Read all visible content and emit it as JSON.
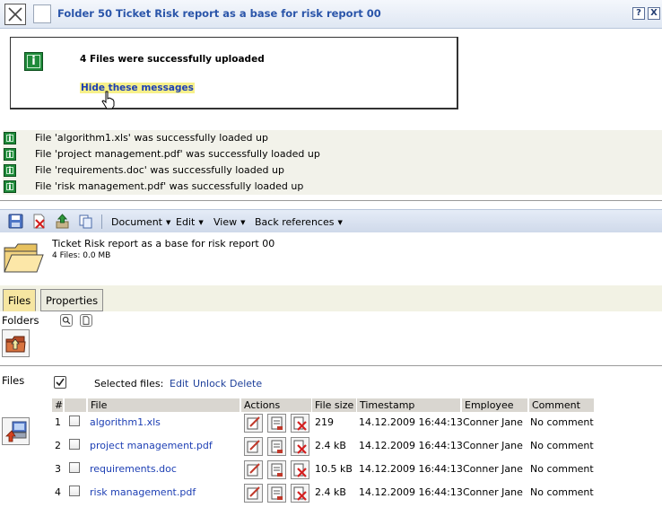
{
  "window": {
    "title": "Folder 50 Ticket Risk report as a base for risk report 00",
    "help_label": "?",
    "close_label": "X"
  },
  "message": {
    "text": "4 Files were successfully uploaded",
    "hide_link": "Hide these messages"
  },
  "upload_messages": [
    "File 'algorithm1.xls' was successfully loaded up",
    "File 'project management.pdf' was successfully loaded up",
    "File 'requirements.doc' was successfully loaded up",
    "File 'risk management.pdf' was successfully loaded up"
  ],
  "toolbar": {
    "icons": [
      "save-icon",
      "delete-icon",
      "upload-icon",
      "copy-icon"
    ],
    "menus": [
      {
        "label": "Document"
      },
      {
        "label": "Edit"
      },
      {
        "label": "View"
      },
      {
        "label": "Back references"
      }
    ]
  },
  "ticket": {
    "title": "Ticket Risk report as a base for risk report 00",
    "summary": "4 Files: 0.0 MB"
  },
  "tabs": [
    {
      "label": "Files",
      "active": true
    },
    {
      "label": "Properties",
      "active": false
    }
  ],
  "folders": {
    "label": "Folders"
  },
  "files": {
    "label": "Files",
    "selected_label": "Selected files:",
    "selected_actions": [
      "Edit",
      "Unlock",
      "Delete"
    ],
    "columns": [
      "#",
      "",
      "File",
      "Actions",
      "File size",
      "Timestamp",
      "Employee",
      "Comment"
    ],
    "rows": [
      {
        "num": "1",
        "name": "algorithm1.xls",
        "size": "219",
        "timestamp": "14.12.2009 16:44:13",
        "employee": "Conner Jane",
        "comment": "No comment"
      },
      {
        "num": "2",
        "name": "project management.pdf",
        "size": "2.4 kB",
        "timestamp": "14.12.2009 16:44:13",
        "employee": "Conner Jane",
        "comment": "No comment"
      },
      {
        "num": "3",
        "name": "requirements.doc",
        "size": "10.5 kB",
        "timestamp": "14.12.2009 16:44:13",
        "employee": "Conner Jane",
        "comment": "No comment"
      },
      {
        "num": "4",
        "name": "risk management.pdf",
        "size": "2.4 kB",
        "timestamp": "14.12.2009 16:44:13",
        "employee": "Conner Jane",
        "comment": "No comment"
      }
    ]
  },
  "colors": {
    "title": "#2a55a9",
    "link": "#1d3fb4",
    "info_green": "#1f8a3a",
    "active_tab": "#f6e6a1"
  }
}
